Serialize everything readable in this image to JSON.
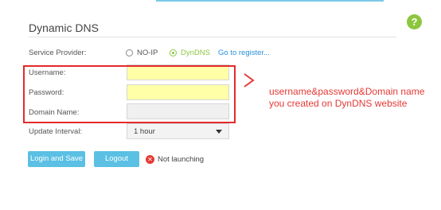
{
  "page": {
    "title": "Dynamic DNS",
    "help_label": "?"
  },
  "service_provider": {
    "label": "Service Provider:",
    "options": [
      {
        "label": "NO-IP",
        "selected": false
      },
      {
        "label": "DynDNS",
        "selected": true
      }
    ],
    "register_link": "Go to register..."
  },
  "fields": {
    "username_label": "Username:",
    "username_value": "",
    "password_label": "Password:",
    "password_value": "",
    "domain_label": "Domain Name:",
    "domain_value": ""
  },
  "update_interval": {
    "label": "Update Interval:",
    "value": "1 hour"
  },
  "buttons": {
    "login_save": "Login and Save",
    "logout": "Logout"
  },
  "status": {
    "icon_glyph": "✕",
    "text": "Not launching"
  },
  "annotation": {
    "text": "username&password&Domain name you created on DynDNS website"
  },
  "colors": {
    "accent_green": "#8cc63f",
    "button_blue": "#5bc0e3",
    "annotation_red": "#e53935",
    "active_field": "#ffffa8"
  }
}
